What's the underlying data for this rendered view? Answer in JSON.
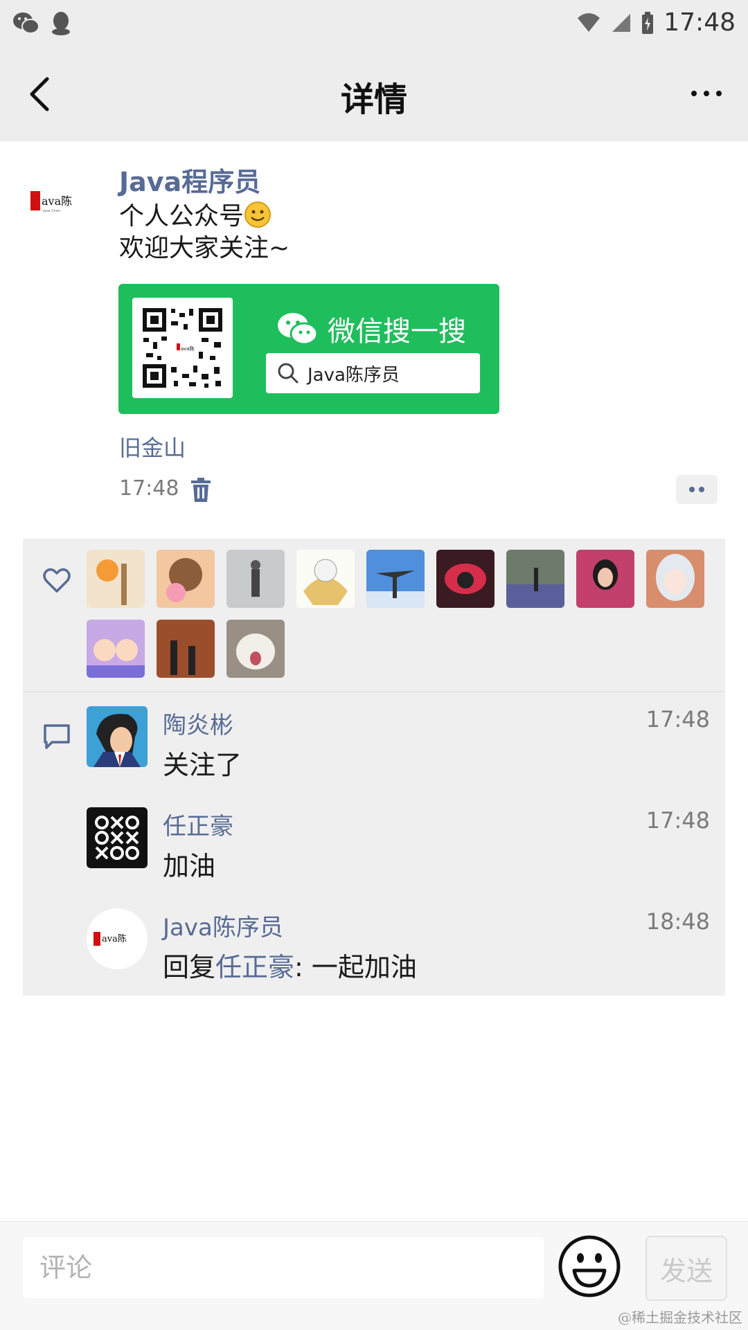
{
  "status_bar": {
    "time": "17:48"
  },
  "nav": {
    "title": "详情"
  },
  "post": {
    "author": "Java程序员",
    "text_line1": "个人公众号",
    "text_line2": "欢迎大家关注~",
    "card": {
      "title": "微信搜一搜",
      "search_text": "Java陈序员"
    },
    "location": "旧金山",
    "time": "17:48"
  },
  "likes": {
    "avatars": [
      "flower-photo",
      "bear-cartoon",
      "snow-walk-photo",
      "cat-cartoon",
      "man-sky-photo",
      "cartoon-girl-red",
      "park-photo",
      "girl-photo",
      "anime-girl",
      "cartoon-kids",
      "silhouette-photo",
      "cat-photo"
    ]
  },
  "comments": [
    {
      "name": "陶炎彬",
      "time": "17:48",
      "text": "关注了"
    },
    {
      "name": "任正豪",
      "time": "17:48",
      "text": "加油"
    },
    {
      "name": "Java陈序员",
      "time": "18:48",
      "reply_prefix": "回复",
      "reply_to": "任正豪",
      "text": ": 一起加油"
    }
  ],
  "bottom": {
    "placeholder": "评论",
    "send_label": "发送"
  },
  "watermark": "@稀土掘金技术社区"
}
